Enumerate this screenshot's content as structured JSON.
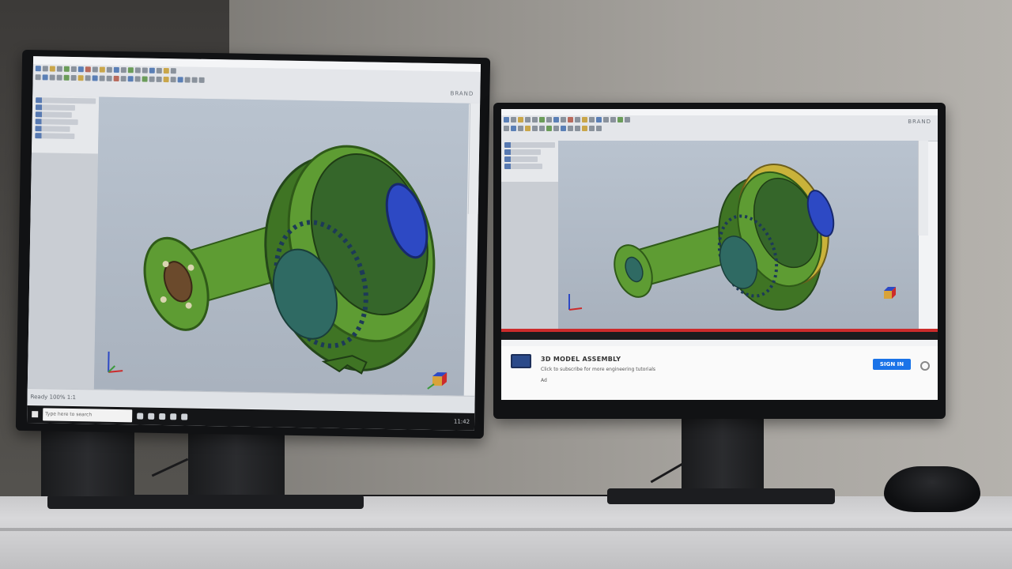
{
  "left_monitor": {
    "brand": "BRAND",
    "status_text": "Ready 100% 1:1",
    "taskbar_search": "Type here to search",
    "taskbar_clock": "11:42"
  },
  "right_monitor": {
    "brand": "BRAND",
    "card": {
      "title": "3D MODEL ASSEMBLY",
      "subtitle": "Click to subscribe for more engineering tutorials",
      "meta": "Ad",
      "button_label": "SIGN IN"
    }
  },
  "colors": {
    "part_green": "#5e9c33",
    "part_dark_green": "#3f7424",
    "part_blue": "#2d49c4",
    "part_yellow": "#c9b23a",
    "accent_red": "#cc2b2b",
    "button_blue": "#1a73e8"
  },
  "icons": [
    "axis-triad-icon",
    "navigation-cube-icon",
    "settings-gear-icon",
    "windows-start-icon"
  ]
}
